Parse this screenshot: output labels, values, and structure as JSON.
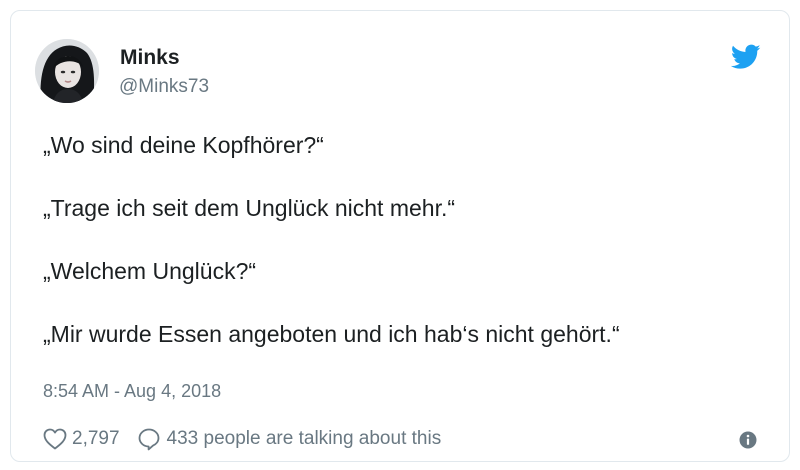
{
  "user": {
    "display_name": "Minks",
    "handle": "@Minks73",
    "avatar_icon": "profile-photo"
  },
  "tweet": {
    "lines": [
      "„Wo sind deine Kopfhörer?“",
      "„Trage ich seit dem Unglück nicht mehr.“",
      "„Welchem Unglück?“",
      "„Mir wurde Essen angeboten und ich hab‘s nicht gehört.“"
    ],
    "timestamp": "8:54 AM - Aug 4, 2018"
  },
  "actions": {
    "likes_count": "2,797",
    "reply_text": "433 people are talking about this"
  },
  "icons": {
    "brand": "twitter-bird-icon",
    "like": "heart-icon",
    "reply": "speech-bubble-icon",
    "info": "info-icon"
  },
  "colors": {
    "brand_blue": "#1da1f2",
    "text": "#1c2022",
    "muted": "#697882",
    "border": "#e1e8ed"
  }
}
